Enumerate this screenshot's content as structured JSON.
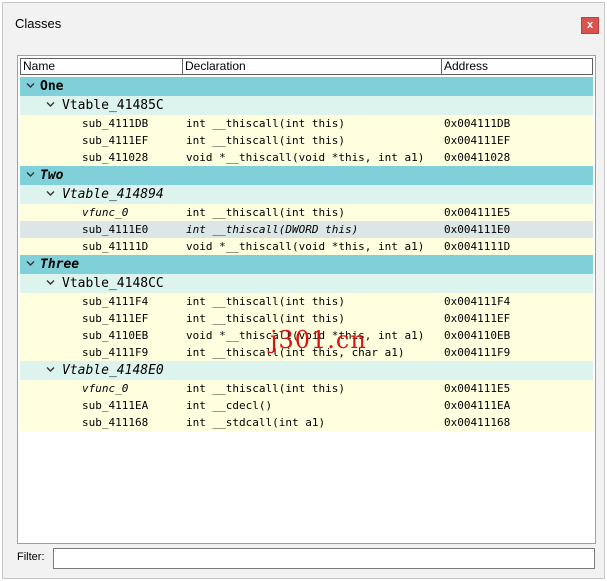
{
  "window": {
    "title": "Classes",
    "close_label": "x"
  },
  "columns": {
    "name": "Name",
    "declaration": "Declaration",
    "address": "Address"
  },
  "colors": {
    "class_row": "#7fd0d8",
    "vtable_row": "#dcf3ee",
    "function_row": "#ffffe0",
    "selected_row": "#dce6e6"
  },
  "classes": [
    {
      "name": "One",
      "italic": false,
      "vtables": [
        {
          "name": "Vtable_41485C",
          "italic": false,
          "functions": [
            {
              "name": "sub_4111DB",
              "declaration": "int __thiscall(int this)",
              "address": "0x004111DB"
            },
            {
              "name": "sub_4111EF",
              "declaration": "int __thiscall(int this)",
              "address": "0x004111EF"
            },
            {
              "name": "sub_411028",
              "declaration": "void *__thiscall(void *this, int a1)",
              "address": "0x00411028"
            }
          ]
        }
      ]
    },
    {
      "name": "Two",
      "italic": true,
      "vtables": [
        {
          "name": "Vtable_414894",
          "italic": true,
          "functions": [
            {
              "name": "vfunc_0",
              "declaration": "int __thiscall(int this)",
              "address": "0x004111E5",
              "italic_name": true
            },
            {
              "name": "sub_4111E0",
              "declaration": "int __thiscall(DWORD this)",
              "address": "0x004111E0",
              "italic_decl": true,
              "selected": true
            },
            {
              "name": "sub_41111D",
              "declaration": "void *__thiscall(void *this, int a1)",
              "address": "0x0041111D"
            }
          ]
        }
      ]
    },
    {
      "name": "Three",
      "italic": true,
      "vtables": [
        {
          "name": "Vtable_4148CC",
          "italic": false,
          "functions": [
            {
              "name": "sub_4111F4",
              "declaration": "int __thiscall(int this)",
              "address": "0x004111F4"
            },
            {
              "name": "sub_4111EF",
              "declaration": "int __thiscall(int this)",
              "address": "0x004111EF"
            },
            {
              "name": "sub_4110EB",
              "declaration": "void *__thiscall(void *this, int a1)",
              "address": "0x004110EB"
            },
            {
              "name": "sub_4111F9",
              "declaration": "int __thiscall(int this, char a1)",
              "address": "0x004111F9"
            }
          ]
        },
        {
          "name": "Vtable_4148E0",
          "italic": true,
          "functions": [
            {
              "name": "vfunc_0",
              "declaration": "int __thiscall(int this)",
              "address": "0x004111E5",
              "italic_name": true
            },
            {
              "name": "sub_4111EA",
              "declaration": "int __cdecl()",
              "address": "0x004111EA"
            },
            {
              "name": "sub_411168",
              "declaration": "int __stdcall(int a1)",
              "address": "0x00411168"
            }
          ]
        }
      ]
    }
  ],
  "watermark": "j301.cn",
  "filter": {
    "label": "Filter:",
    "value": ""
  },
  "icons": {
    "expanded": "chevron-down-icon",
    "close": "close-icon"
  }
}
